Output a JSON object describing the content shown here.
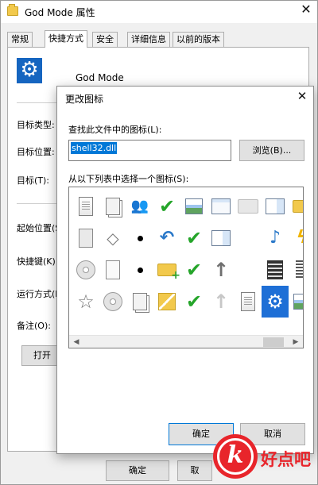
{
  "window": {
    "title": "God Mode 属性",
    "close_glyph": "✕",
    "tabs": [
      "常规",
      "快捷方式",
      "安全",
      "详细信息",
      "以前的版本"
    ],
    "name": "God Mode",
    "fields": [
      {
        "label": "目标类型:"
      },
      {
        "label": "目标位置:"
      },
      {
        "label": "目标(T):"
      },
      {
        "label": "起始位置(S"
      },
      {
        "label": "快捷键(K):"
      },
      {
        "label": "运行方式(R"
      },
      {
        "label": "备注(O):"
      }
    ],
    "open_button_label": "打开",
    "ok_button_label": "确定",
    "cancel_button_label": "取"
  },
  "dialog": {
    "title": "更改图标",
    "close_glyph": "✕",
    "find_label": "查找此文件中的图标(L):",
    "path_value": "shell32.dll",
    "browse_label": "浏览(B)...",
    "list_label": "从以下列表中选择一个图标(S):",
    "ok_label": "确定",
    "cancel_label": "取消",
    "icons": [
      "document-icon",
      "window-copy-icon",
      "users-icon",
      "green-check-icon",
      "media-document-icon",
      "window-icon",
      "folder-outline-icon",
      "image-window-icon",
      "folder-arrow-icon",
      "book-icon",
      "tag-icon",
      "dot-icon",
      "undo-arrow-icon",
      "green-check-icon",
      "chart-window-icon",
      "blank-icon",
      "music-note-icon",
      "lightning-icon",
      "disc-drive-icon",
      "blank-document-icon",
      "dot-icon",
      "folder-add-icon",
      "users-check-icon",
      "up-arrow-icon",
      "blank-icon",
      "film-icon",
      "list-icon",
      "star-icon",
      "cd-icon",
      "copy-check-icon",
      "multi-folder-icon",
      "users-check-icon",
      "up-arrow-light-icon",
      "document-icon",
      "gear-icon",
      "image-icon"
    ],
    "selected_index": 34
  },
  "watermark": {
    "text": "好点吧",
    "badge_letter": "k"
  },
  "colors": {
    "selection": "#0078d7",
    "accent": "#1565c0",
    "watermark": "#e8252b"
  }
}
